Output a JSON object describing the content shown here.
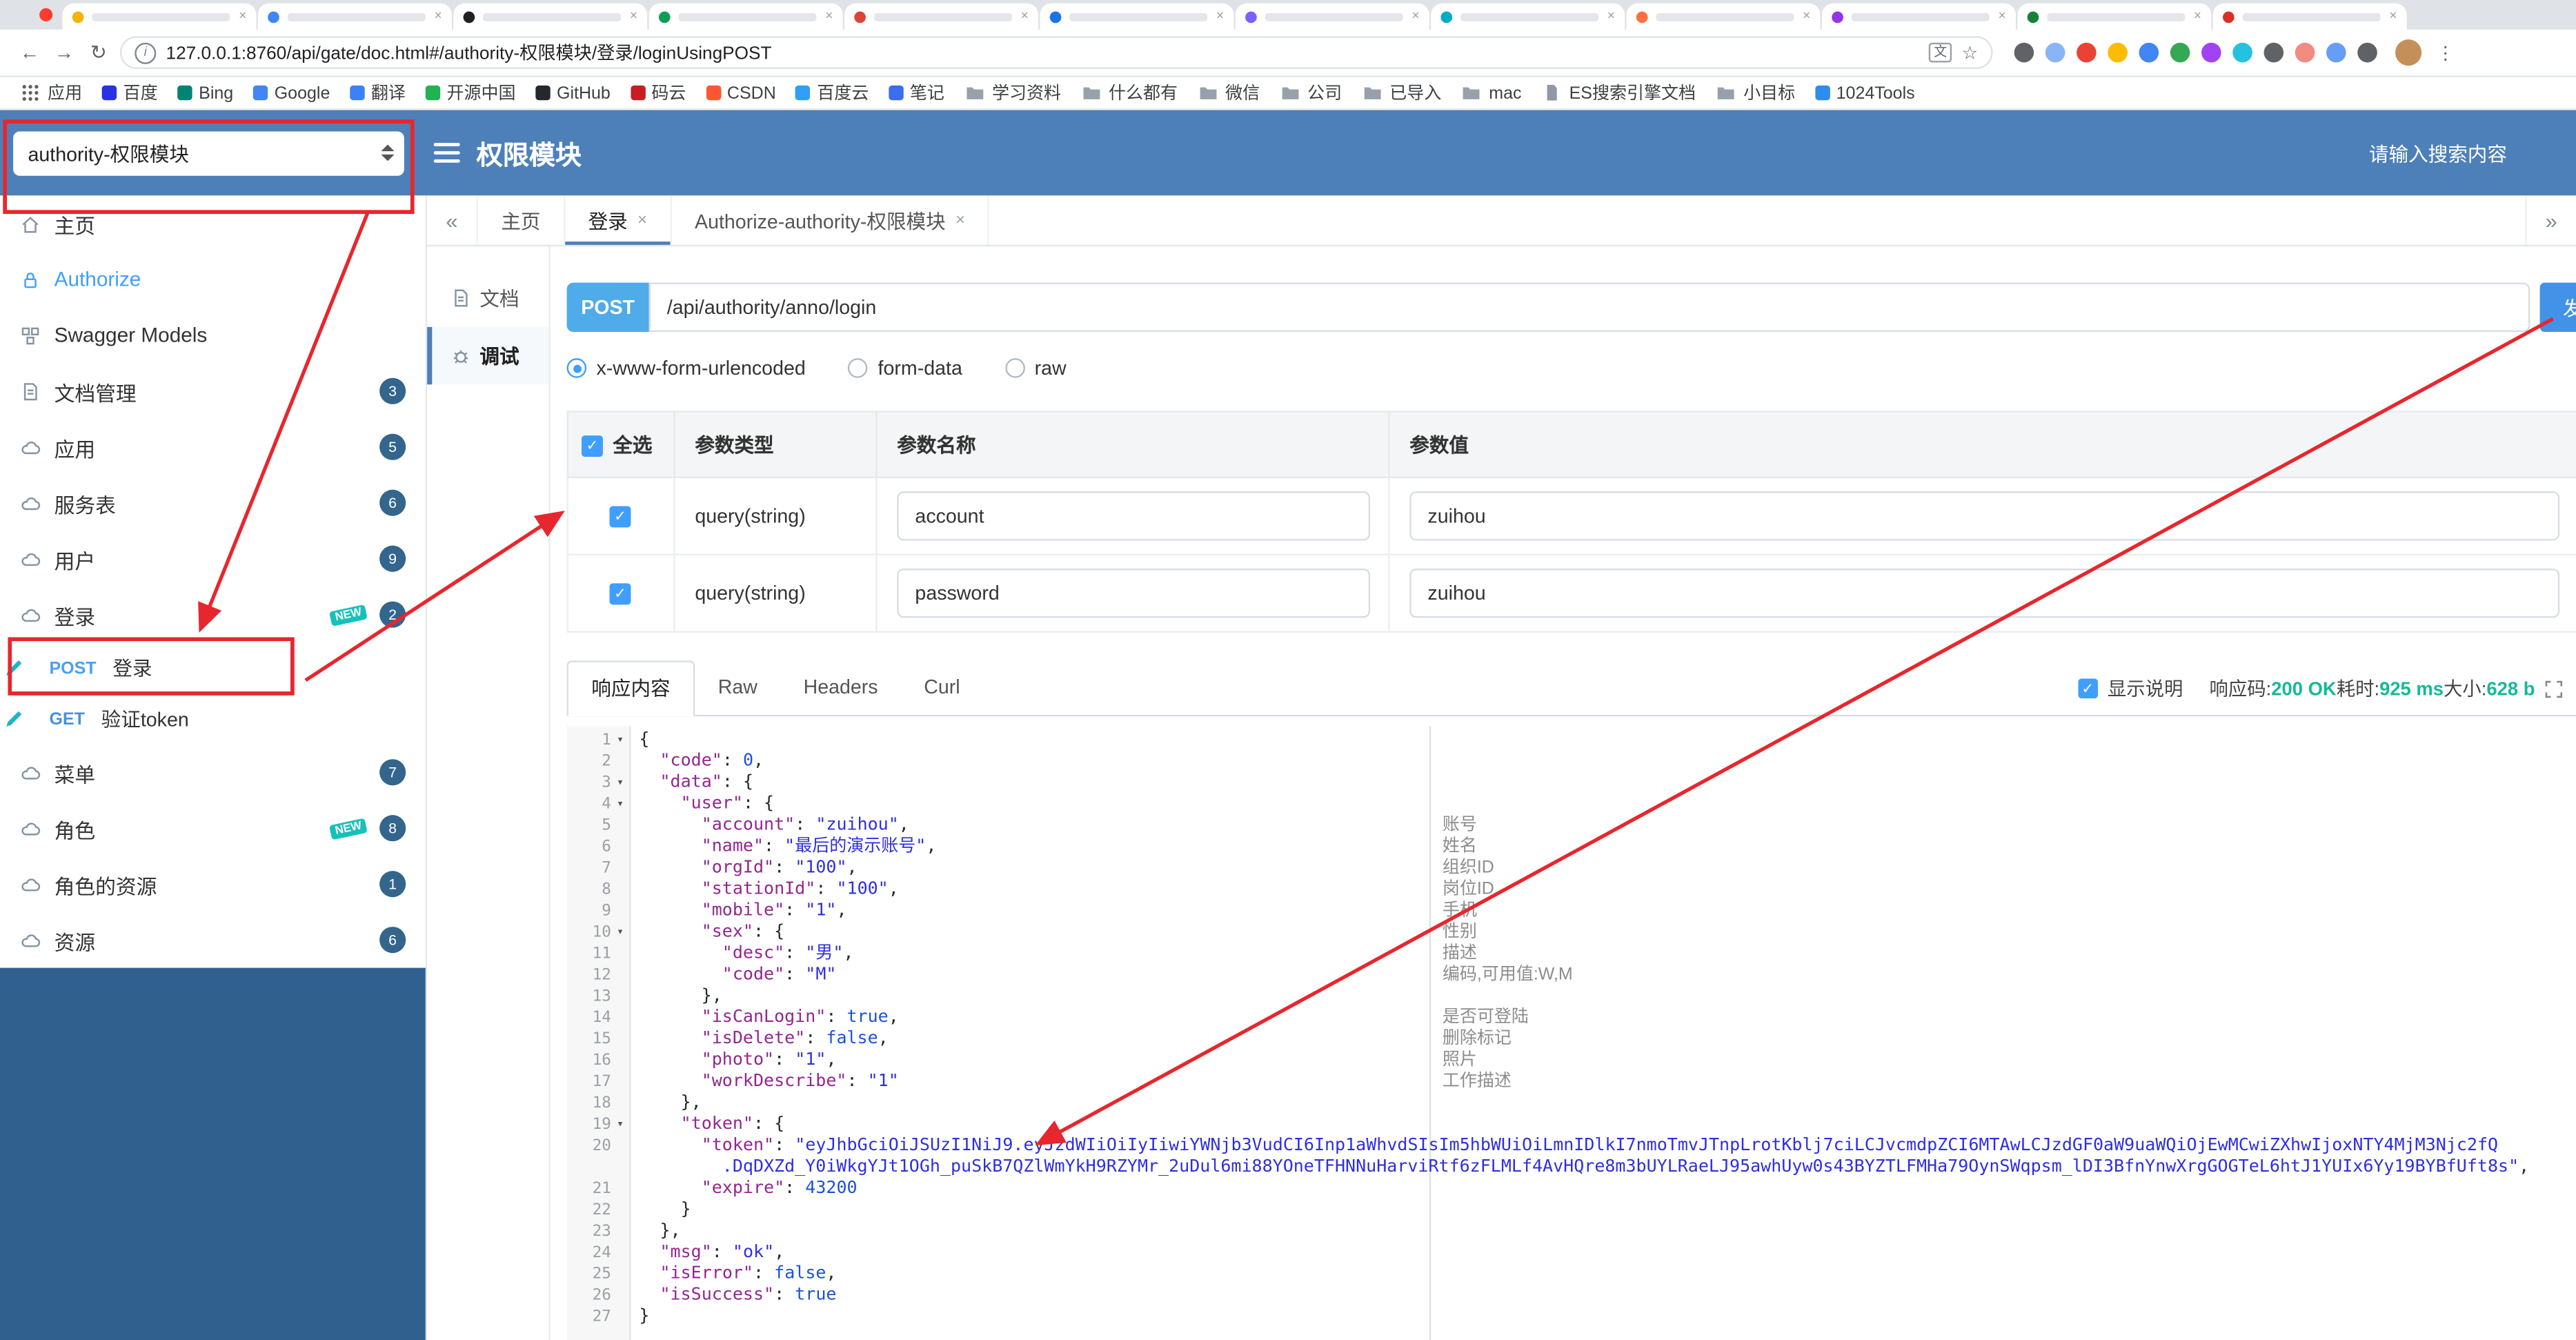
{
  "colors": {
    "header": "#4d80b9",
    "sidebar_dark": "#30618e",
    "accent": "#409eff",
    "post_badge": "#4fabea",
    "send_button": "#4292e8",
    "annotation": "#e8262d",
    "success": "#16b998",
    "badge": "#33658d",
    "new_tag": "#17c1b9",
    "json_key": "#92278f",
    "json_string": "#2f2fe0",
    "json_literal": "#1c52d8"
  },
  "ui": {
    "close": "×",
    "chevron_left": "«",
    "chevron_right": "»",
    "fold_caret": "▾",
    "check": "✓",
    "new_label": "NEW",
    "kebab": "⋮",
    "star": "☆",
    "back": "←",
    "forward": "→",
    "reload": "↻",
    "info": "i",
    "translate": "文"
  },
  "browser": {
    "url": "127.0.0.1:8760/api/gate/doc.html#/authority-权限模块/登录/loginUsingPOST",
    "tab_favicon_colors": [
      "#f4b400",
      "#4285f4",
      "#202124",
      "#0f9d58",
      "#db4437",
      "#1a73e8",
      "#7b61ff",
      "#00acc1",
      "#ff7043",
      "#9334e6",
      "#188038",
      "#d93025"
    ],
    "extension_icon_colors": [
      "#5f6368",
      "#8ab4f8",
      "#ea4335",
      "#fbbc05",
      "#4285f4",
      "#34a853",
      "#a142f4",
      "#24c1e0",
      "#5f6368",
      "#f28b82",
      "#669df6",
      "#5f6368"
    ],
    "bookmarks": [
      {
        "label": "应用",
        "icon": "apps",
        "color": "#5f6368"
      },
      {
        "label": "百度",
        "icon": "site",
        "color": "#2932e1"
      },
      {
        "label": "Bing",
        "icon": "site",
        "color": "#008373"
      },
      {
        "label": "Google",
        "icon": "site",
        "color": "#4285f4"
      },
      {
        "label": "翻译",
        "icon": "site",
        "color": "#3b82f6"
      },
      {
        "label": "开源中国",
        "icon": "site",
        "color": "#21b351"
      },
      {
        "label": "GitHub",
        "icon": "site",
        "color": "#24292e"
      },
      {
        "label": "码云",
        "icon": "site",
        "color": "#c71d23"
      },
      {
        "label": "CSDN",
        "icon": "site",
        "color": "#fc5531"
      },
      {
        "label": "百度云",
        "icon": "site",
        "color": "#2ea0f6"
      },
      {
        "label": "笔记",
        "icon": "site",
        "color": "#3a6df0"
      },
      {
        "label": "学习资料",
        "icon": "folder"
      },
      {
        "label": "什么都有",
        "icon": "folder"
      },
      {
        "label": "微信",
        "icon": "folder"
      },
      {
        "label": "公司",
        "icon": "folder"
      },
      {
        "label": "已导入",
        "icon": "folder"
      },
      {
        "label": "mac",
        "icon": "folder"
      },
      {
        "label": "ES搜索引擎文档",
        "icon": "docfile",
        "color": "#7c4dff"
      },
      {
        "label": "小目标",
        "icon": "folder"
      },
      {
        "label": "1024Tools",
        "icon": "site",
        "color": "#2d8cf0"
      }
    ]
  },
  "header": {
    "group_select": "authority-权限模块",
    "title": "权限模块",
    "search_placeholder": "请输入搜索内容"
  },
  "sidebar": {
    "items": [
      {
        "key": "home",
        "label": "主页",
        "icon": "home"
      },
      {
        "key": "authorize",
        "label": "Authorize",
        "icon": "lock",
        "accent": true
      },
      {
        "key": "swagger-models",
        "label": "Swagger Models",
        "icon": "models"
      },
      {
        "key": "doc-manage",
        "label": "文档管理",
        "icon": "docedit",
        "badge": "3"
      },
      {
        "key": "app",
        "label": "应用",
        "icon": "cloud",
        "badge": "5"
      },
      {
        "key": "service",
        "label": "服务表",
        "icon": "cloud",
        "badge": "6"
      },
      {
        "key": "user",
        "label": "用户",
        "icon": "cloud",
        "badge": "9"
      },
      {
        "key": "login",
        "label": "登录",
        "icon": "cloud",
        "badge": "2",
        "isnew": true,
        "children": [
          {
            "method": "POST",
            "label": "登录",
            "highlight": true
          },
          {
            "method": "GET",
            "label": "验证token"
          }
        ]
      },
      {
        "key": "menu",
        "label": "菜单",
        "icon": "cloud",
        "badge": "7"
      },
      {
        "key": "role",
        "label": "角色",
        "icon": "cloud",
        "badge": "8",
        "isnew": true
      },
      {
        "key": "role-resource",
        "label": "角色的资源",
        "icon": "cloud",
        "badge": "1"
      },
      {
        "key": "resource",
        "label": "资源",
        "icon": "cloud",
        "badge": "6"
      }
    ]
  },
  "doc_tabs": {
    "tabs": [
      {
        "label": "主页",
        "closable": false
      },
      {
        "label": "登录",
        "closable": true,
        "active": true
      },
      {
        "label": "Authorize-authority-权限模块",
        "closable": true
      }
    ]
  },
  "mini_side": {
    "items": [
      {
        "label": "文档"
      },
      {
        "label": "调试",
        "active": true
      }
    ]
  },
  "request": {
    "method": "POST",
    "path": "/api/authority/anno/login",
    "send_label": "发送"
  },
  "content_types": [
    {
      "label": "x-www-form-urlencoded",
      "checked": true
    },
    {
      "label": "form-data",
      "checked": false
    },
    {
      "label": "raw",
      "checked": false
    }
  ],
  "params_table": {
    "select_all_label": "全选",
    "headers": [
      "参数类型",
      "参数名称",
      "参数值"
    ],
    "rows": [
      {
        "checked": true,
        "type": "query(string)",
        "name": "account",
        "value": "zuihou"
      },
      {
        "checked": true,
        "type": "query(string)",
        "name": "password",
        "value": "zuihou"
      }
    ]
  },
  "response": {
    "tabs": [
      "响应内容",
      "Raw",
      "Headers",
      "Curl"
    ],
    "active_tab": "响应内容",
    "show_desc_label": "显示说明",
    "meta": [
      {
        "label": "响应码:",
        "value": "200 OK"
      },
      {
        "label": "耗时:",
        "value": "925 ms"
      },
      {
        "label": "大小:",
        "value": "628 b"
      }
    ]
  },
  "response_body": {
    "lines": [
      {
        "n": 1,
        "f": 1,
        "s": [
          [
            "pu",
            "{"
          ]
        ]
      },
      {
        "n": 2,
        "s": [
          [
            "pu",
            "  "
          ],
          [
            "key",
            "\"code\""
          ],
          [
            "pu",
            ": "
          ],
          [
            "num",
            "0"
          ],
          [
            "pu",
            ","
          ]
        ]
      },
      {
        "n": 3,
        "f": 1,
        "s": [
          [
            "pu",
            "  "
          ],
          [
            "key",
            "\"data\""
          ],
          [
            "pu",
            ": {"
          ]
        ]
      },
      {
        "n": 4,
        "f": 1,
        "s": [
          [
            "pu",
            "    "
          ],
          [
            "key",
            "\"user\""
          ],
          [
            "pu",
            ": {"
          ]
        ]
      },
      {
        "n": 5,
        "d": "账号",
        "s": [
          [
            "pu",
            "      "
          ],
          [
            "key",
            "\"account\""
          ],
          [
            "pu",
            ": "
          ],
          [
            "str",
            "\"zuihou\""
          ],
          [
            "pu",
            ","
          ]
        ]
      },
      {
        "n": 6,
        "d": "姓名",
        "s": [
          [
            "pu",
            "      "
          ],
          [
            "key",
            "\"name\""
          ],
          [
            "pu",
            ": "
          ],
          [
            "str",
            "\"最后的演示账号\""
          ],
          [
            "pu",
            ","
          ]
        ]
      },
      {
        "n": 7,
        "d": "组织ID",
        "s": [
          [
            "pu",
            "      "
          ],
          [
            "key",
            "\"orgId\""
          ],
          [
            "pu",
            ": "
          ],
          [
            "str",
            "\"100\""
          ],
          [
            "pu",
            ","
          ]
        ]
      },
      {
        "n": 8,
        "d": "岗位ID",
        "s": [
          [
            "pu",
            "      "
          ],
          [
            "key",
            "\"stationId\""
          ],
          [
            "pu",
            ": "
          ],
          [
            "str",
            "\"100\""
          ],
          [
            "pu",
            ","
          ]
        ]
      },
      {
        "n": 9,
        "d": "手机",
        "s": [
          [
            "pu",
            "      "
          ],
          [
            "key",
            "\"mobile\""
          ],
          [
            "pu",
            ": "
          ],
          [
            "str",
            "\"1\""
          ],
          [
            "pu",
            ","
          ]
        ]
      },
      {
        "n": 10,
        "f": 1,
        "d": "性别",
        "s": [
          [
            "pu",
            "      "
          ],
          [
            "key",
            "\"sex\""
          ],
          [
            "pu",
            ": {"
          ]
        ]
      },
      {
        "n": 11,
        "d": "描述",
        "s": [
          [
            "pu",
            "        "
          ],
          [
            "key",
            "\"desc\""
          ],
          [
            "pu",
            ": "
          ],
          [
            "str",
            "\"男\""
          ],
          [
            "pu",
            ","
          ]
        ]
      },
      {
        "n": 12,
        "d": "编码,可用值:W,M",
        "s": [
          [
            "pu",
            "        "
          ],
          [
            "key",
            "\"code\""
          ],
          [
            "pu",
            ": "
          ],
          [
            "str",
            "\"M\""
          ]
        ]
      },
      {
        "n": 13,
        "s": [
          [
            "pu",
            "      },"
          ]
        ]
      },
      {
        "n": 14,
        "d": "是否可登陆",
        "s": [
          [
            "pu",
            "      "
          ],
          [
            "key",
            "\"isCanLogin\""
          ],
          [
            "pu",
            ": "
          ],
          [
            "bool",
            "true"
          ],
          [
            "pu",
            ","
          ]
        ]
      },
      {
        "n": 15,
        "d": "删除标记",
        "s": [
          [
            "pu",
            "      "
          ],
          [
            "key",
            "\"isDelete\""
          ],
          [
            "pu",
            ": "
          ],
          [
            "bool",
            "false"
          ],
          [
            "pu",
            ","
          ]
        ]
      },
      {
        "n": 16,
        "d": "照片",
        "s": [
          [
            "pu",
            "      "
          ],
          [
            "key",
            "\"photo\""
          ],
          [
            "pu",
            ": "
          ],
          [
            "str",
            "\"1\""
          ],
          [
            "pu",
            ","
          ]
        ]
      },
      {
        "n": 17,
        "d": "工作描述",
        "s": [
          [
            "pu",
            "      "
          ],
          [
            "key",
            "\"workDescribe\""
          ],
          [
            "pu",
            ": "
          ],
          [
            "str",
            "\"1\""
          ]
        ]
      },
      {
        "n": 18,
        "s": [
          [
            "pu",
            "    },"
          ]
        ]
      },
      {
        "n": 19,
        "f": 1,
        "s": [
          [
            "pu",
            "    "
          ],
          [
            "key",
            "\"token\""
          ],
          [
            "pu",
            ": {"
          ]
        ]
      },
      {
        "n": 20,
        "s": [
          [
            "pu",
            "      "
          ],
          [
            "key",
            "\"token\""
          ],
          [
            "pu",
            ": "
          ],
          [
            "str",
            "\"eyJhbGciOiJSUzI1NiJ9.eyJzdWIiOiIyIiwiYWNjb3VudCI6Inp1aWhvdSIsIm5hbWUiOiLmnIDlkI7nmoTmvJTnpLrotKblj7ciLCJvcmdpZCI6MTAwLCJzdGF0aW9uaWQiOjEwMCwiZXhwIjoxNTY4MjM3Njc2fQ"
          ]
        ]
      },
      {
        "n": null,
        "s": [
          [
            "str",
            "        .DqDXZd_Y0iWkgYJt1OGh_puSkB7QZlWmYkH9RZYMr_2uDul6mi88YOneTFHNNuHarviRtf6zFLMLf4AvHQre8m3bUYLRaeLJ95awhUyw0s43BYZTLFMHa79OynSWqpsm_lDI3BfnYnwXrgGOGTeL6htJ1YUIx6Yy19BYBfUft8s\""
          ],
          [
            "pu",
            ","
          ]
        ]
      },
      {
        "n": 21,
        "s": [
          [
            "pu",
            "      "
          ],
          [
            "key",
            "\"expire\""
          ],
          [
            "pu",
            ": "
          ],
          [
            "num",
            "43200"
          ]
        ]
      },
      {
        "n": 22,
        "s": [
          [
            "pu",
            "    }"
          ]
        ]
      },
      {
        "n": 23,
        "s": [
          [
            "pu",
            "  },"
          ]
        ]
      },
      {
        "n": 24,
        "s": [
          [
            "pu",
            "  "
          ],
          [
            "key",
            "\"msg\""
          ],
          [
            "pu",
            ": "
          ],
          [
            "str",
            "\"ok\""
          ],
          [
            "pu",
            ","
          ]
        ]
      },
      {
        "n": 25,
        "s": [
          [
            "pu",
            "  "
          ],
          [
            "key",
            "\"isError\""
          ],
          [
            "pu",
            ": "
          ],
          [
            "bool",
            "false"
          ],
          [
            "pu",
            ","
          ]
        ]
      },
      {
        "n": 26,
        "s": [
          [
            "pu",
            "  "
          ],
          [
            "key",
            "\"isSuccess\""
          ],
          [
            "pu",
            ": "
          ],
          [
            "bool",
            "true"
          ]
        ]
      },
      {
        "n": 27,
        "s": [
          [
            "pu",
            "}"
          ]
        ]
      }
    ]
  }
}
